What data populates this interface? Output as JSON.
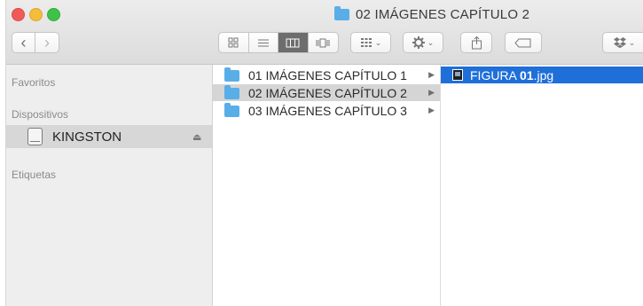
{
  "window": {
    "title": "02 IMÁGENES CAPÍTULO 2"
  },
  "toolbar": {
    "back_glyph": "‹",
    "forward_glyph": "›",
    "view_icons": [
      "icon-view-icon",
      "list-view-icon",
      "column-view-icon",
      "cover-flow-icon"
    ],
    "arrange_icon": "arrange-grid-icon",
    "action_icon": "gear-icon",
    "share_icon": "share-icon",
    "tag_icon": "tag-icon",
    "dropbox_icon": "dropbox-icon",
    "chevron": "⌄"
  },
  "sidebar": {
    "favorites_header": "Favoritos",
    "devices_header": "Dispositivos",
    "devices": [
      {
        "label": "KINGSTON",
        "eject": "⏏"
      }
    ],
    "tags_header": "Etiquetas"
  },
  "columns": {
    "folders": [
      {
        "label": "01 IMÁGENES CAPÍTULO 1",
        "arrow": "▶"
      },
      {
        "label": "02 IMÁGENES CAPÍTULO 2",
        "arrow": "▶"
      },
      {
        "label": "03 IMÁGENES CAPÍTULO 3",
        "arrow": "▶"
      }
    ],
    "files": [
      {
        "name_prefix": "FIGURA ",
        "name_bold": "01",
        "name_suffix": ".jpg"
      }
    ]
  },
  "colors": {
    "selection_blue": "#1f6fd9",
    "folder_blue": "#5aaee8",
    "sidebar_bg": "#eeeeee"
  }
}
